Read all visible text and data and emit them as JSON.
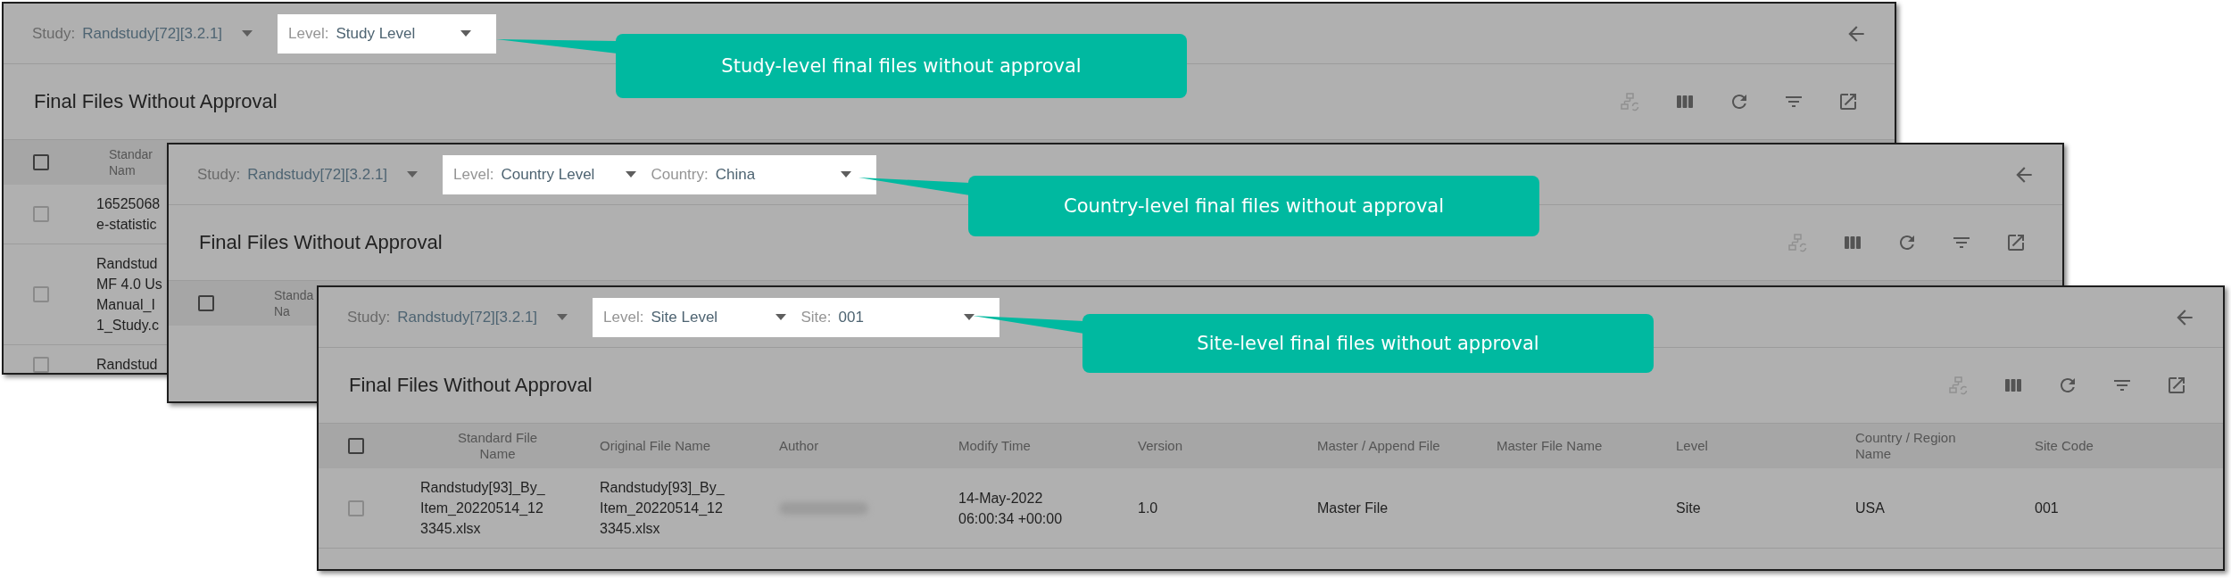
{
  "windows": [
    {
      "filters": [
        {
          "label": "Study:",
          "value": "Randstudy[72][3.2.1]",
          "highlighted": false
        },
        {
          "label": "Level:",
          "value": "Study Level",
          "highlighted": true
        }
      ],
      "title": "Final Files Without Approval",
      "toolbar": [
        {
          "kind": "hierarchy",
          "disabled": true
        },
        {
          "kind": "columns",
          "disabled": false
        },
        {
          "kind": "refresh",
          "disabled": false
        },
        {
          "kind": "filter",
          "disabled": false
        },
        {
          "kind": "export",
          "disabled": false
        }
      ],
      "select_all_checked": false,
      "columns": [
        "Standar\nNam"
      ],
      "rows": [
        {
          "checked": false,
          "disabled": true,
          "cells": [
            "16525068\ne-statistic"
          ]
        },
        {
          "checked": false,
          "disabled": true,
          "cells": [
            "Randstud\nMF 4.0 Us\nManual_I\n1_Study.c"
          ]
        },
        {
          "checked": false,
          "disabled": true,
          "cells": [
            "Randstud"
          ]
        }
      ],
      "callout": "Study-level final files without approval"
    },
    {
      "filters": [
        {
          "label": "Study:",
          "value": "Randstudy[72][3.2.1]",
          "highlighted": false
        },
        {
          "label": "Level:",
          "value": "Country Level",
          "highlighted": true
        },
        {
          "label": "Country:",
          "value": "China",
          "highlighted": true
        }
      ],
      "title": "Final Files Without Approval",
      "toolbar": [
        {
          "kind": "hierarchy",
          "disabled": true
        },
        {
          "kind": "columns",
          "disabled": false
        },
        {
          "kind": "refresh",
          "disabled": false
        },
        {
          "kind": "filter",
          "disabled": false
        },
        {
          "kind": "export",
          "disabled": false
        }
      ],
      "select_all_checked": false,
      "columns": [
        "Standa\nNa"
      ],
      "callout": "Country-level final files without approval"
    },
    {
      "filters": [
        {
          "label": "Study:",
          "value": "Randstudy[72][3.2.1]",
          "highlighted": false
        },
        {
          "label": "Level:",
          "value": "Site Level",
          "highlighted": true
        },
        {
          "label": "Site:",
          "value": "001",
          "highlighted": true
        }
      ],
      "title": "Final Files Without Approval",
      "toolbar": [
        {
          "kind": "hierarchy",
          "disabled": true
        },
        {
          "kind": "columns",
          "disabled": false
        },
        {
          "kind": "refresh",
          "disabled": false
        },
        {
          "kind": "filter",
          "disabled": false
        },
        {
          "kind": "export",
          "disabled": false
        }
      ],
      "select_all_checked": false,
      "columns": [
        "Standard File\nName",
        "Original File Name",
        "Author",
        "Modify Time",
        "Version",
        "Master / Append File",
        "Master File Name",
        "Level",
        "Country / Region\nName",
        "Site Code"
      ],
      "rows": [
        {
          "checked": false,
          "disabled": true,
          "cells": [
            "Randstudy[93]_By_\nItem_20220514_12\n3345.xlsx",
            "Randstudy[93]_By_\nItem_20220514_12\n3345.xlsx",
            {
              "kind": "redacted"
            },
            "14-May-2022\n06:00:34 +00:00",
            "1.0",
            "Master File",
            null,
            "Site",
            "USA",
            "001"
          ]
        }
      ],
      "callout": "Site-level final files without approval"
    }
  ]
}
